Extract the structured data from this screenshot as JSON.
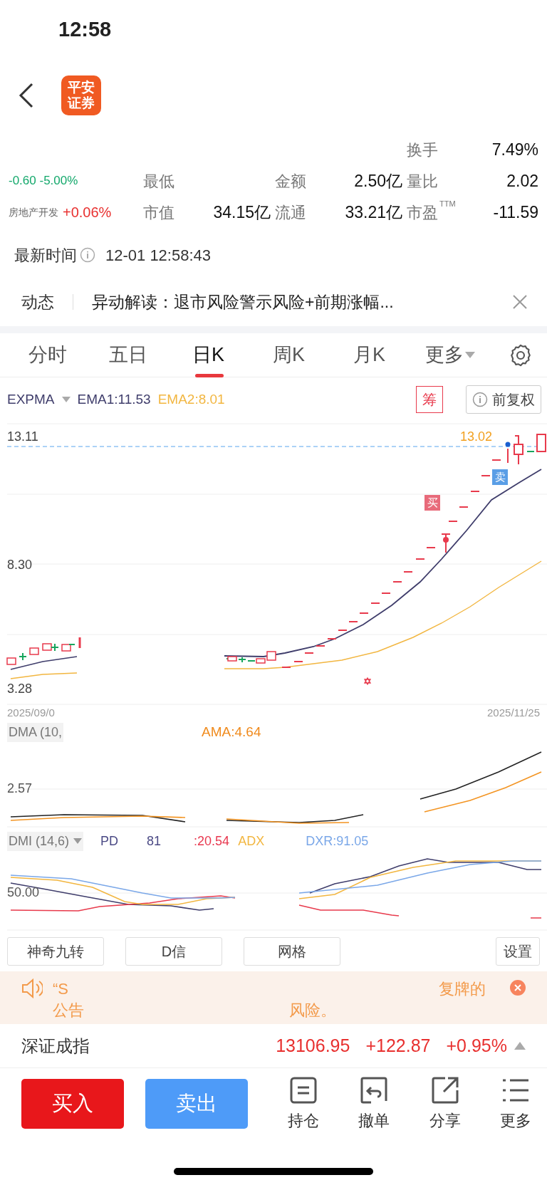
{
  "status_bar": {
    "time": "12:58"
  },
  "nav": {
    "logo": [
      "平安",
      "证券"
    ]
  },
  "quote": {
    "change": "-0.60 -5.00%",
    "sector": "房地产开发",
    "sector_change": "+0.06%",
    "rows": [
      [
        {
          "text": "",
          "kind": "label"
        },
        {
          "text": "",
          "kind": "value"
        },
        {
          "text": "",
          "kind": "label"
        },
        {
          "text": "",
          "kind": "value"
        },
        {
          "text": "换手",
          "kind": "label"
        },
        {
          "text": "7.49%",
          "kind": "value"
        }
      ],
      [
        {
          "text": "最低",
          "kind": "label"
        },
        {
          "text": "",
          "kind": "value"
        },
        {
          "text": "金额",
          "kind": "label"
        },
        {
          "text": "2.50亿",
          "kind": "value"
        },
        {
          "text": "量比",
          "kind": "label"
        },
        {
          "text": "2.02",
          "kind": "value"
        }
      ],
      [
        {
          "text": "市值",
          "kind": "label"
        },
        {
          "text": "34.15亿",
          "kind": "value"
        },
        {
          "text": "流通",
          "kind": "label"
        },
        {
          "text": "33.21亿",
          "kind": "value"
        },
        {
          "text": "市盈",
          "kind": "label",
          "sup": "TTM"
        },
        {
          "text": "-11.59",
          "kind": "value"
        }
      ]
    ]
  },
  "latest_time": {
    "label": "最新时间",
    "value": "12-01 12:58:43"
  },
  "news": {
    "label": "动态",
    "text": "异动解读：退市风险警示风险+前期涨幅..."
  },
  "tabs": [
    {
      "label": "分时",
      "selected": false,
      "kind": "plain"
    },
    {
      "label": "五日",
      "selected": false,
      "kind": "plain"
    },
    {
      "label": "日K",
      "selected": true,
      "kind": "plain"
    },
    {
      "label": "周K",
      "selected": false,
      "kind": "plain"
    },
    {
      "label": "月K",
      "selected": false,
      "kind": "plain"
    },
    {
      "label": "更多",
      "selected": false,
      "kind": "dropdown"
    }
  ],
  "chart": {
    "indicator": "EXPMA",
    "ema1": "EMA1:11.53",
    "ema2": "EMA2:8.01",
    "chip_badge": "筹",
    "adjust": "前复权",
    "y_labels": [
      "13.11",
      "8.30",
      "3.28"
    ],
    "last_price": "13.02",
    "buy_mark": "买",
    "sell_mark": "卖",
    "start_date": "2025/09/0",
    "end_date": "2025/11/25"
  },
  "dma": {
    "title": "DMA (10,",
    "ama": "AMA:4.64",
    "y_label": "2.57"
  },
  "dmi": {
    "title": "DMI (14,6)",
    "items": [
      {
        "text": "PD",
        "color": "#4b4a85"
      },
      {
        "text": "81",
        "color": "#4b4a85"
      },
      {
        "text": ":20.54",
        "color": "#e8384f"
      },
      {
        "text": "ADX",
        "color": "#f2b640"
      },
      {
        "text": "DXR:91.05",
        "color": "#7aa7e8"
      }
    ],
    "y_label": "50.00"
  },
  "tool_buttons": [
    "神奇九转",
    "D信",
    "网格",
    "设置"
  ],
  "notice": {
    "line1_start": "“S",
    "line1_end": "复牌的",
    "line2_start": "公告",
    "line2_end": "风险。"
  },
  "index": {
    "name": "深证成指",
    "value": "13106.95",
    "change": "+122.87",
    "pct": "+0.95%"
  },
  "actions": {
    "buy": "买入",
    "sell": "卖出",
    "tools": [
      {
        "label": "持仓",
        "kind": "position"
      },
      {
        "label": "撤单",
        "kind": "cancel"
      },
      {
        "label": "分享",
        "kind": "share"
      },
      {
        "label": "更多",
        "kind": "menu"
      }
    ]
  }
}
